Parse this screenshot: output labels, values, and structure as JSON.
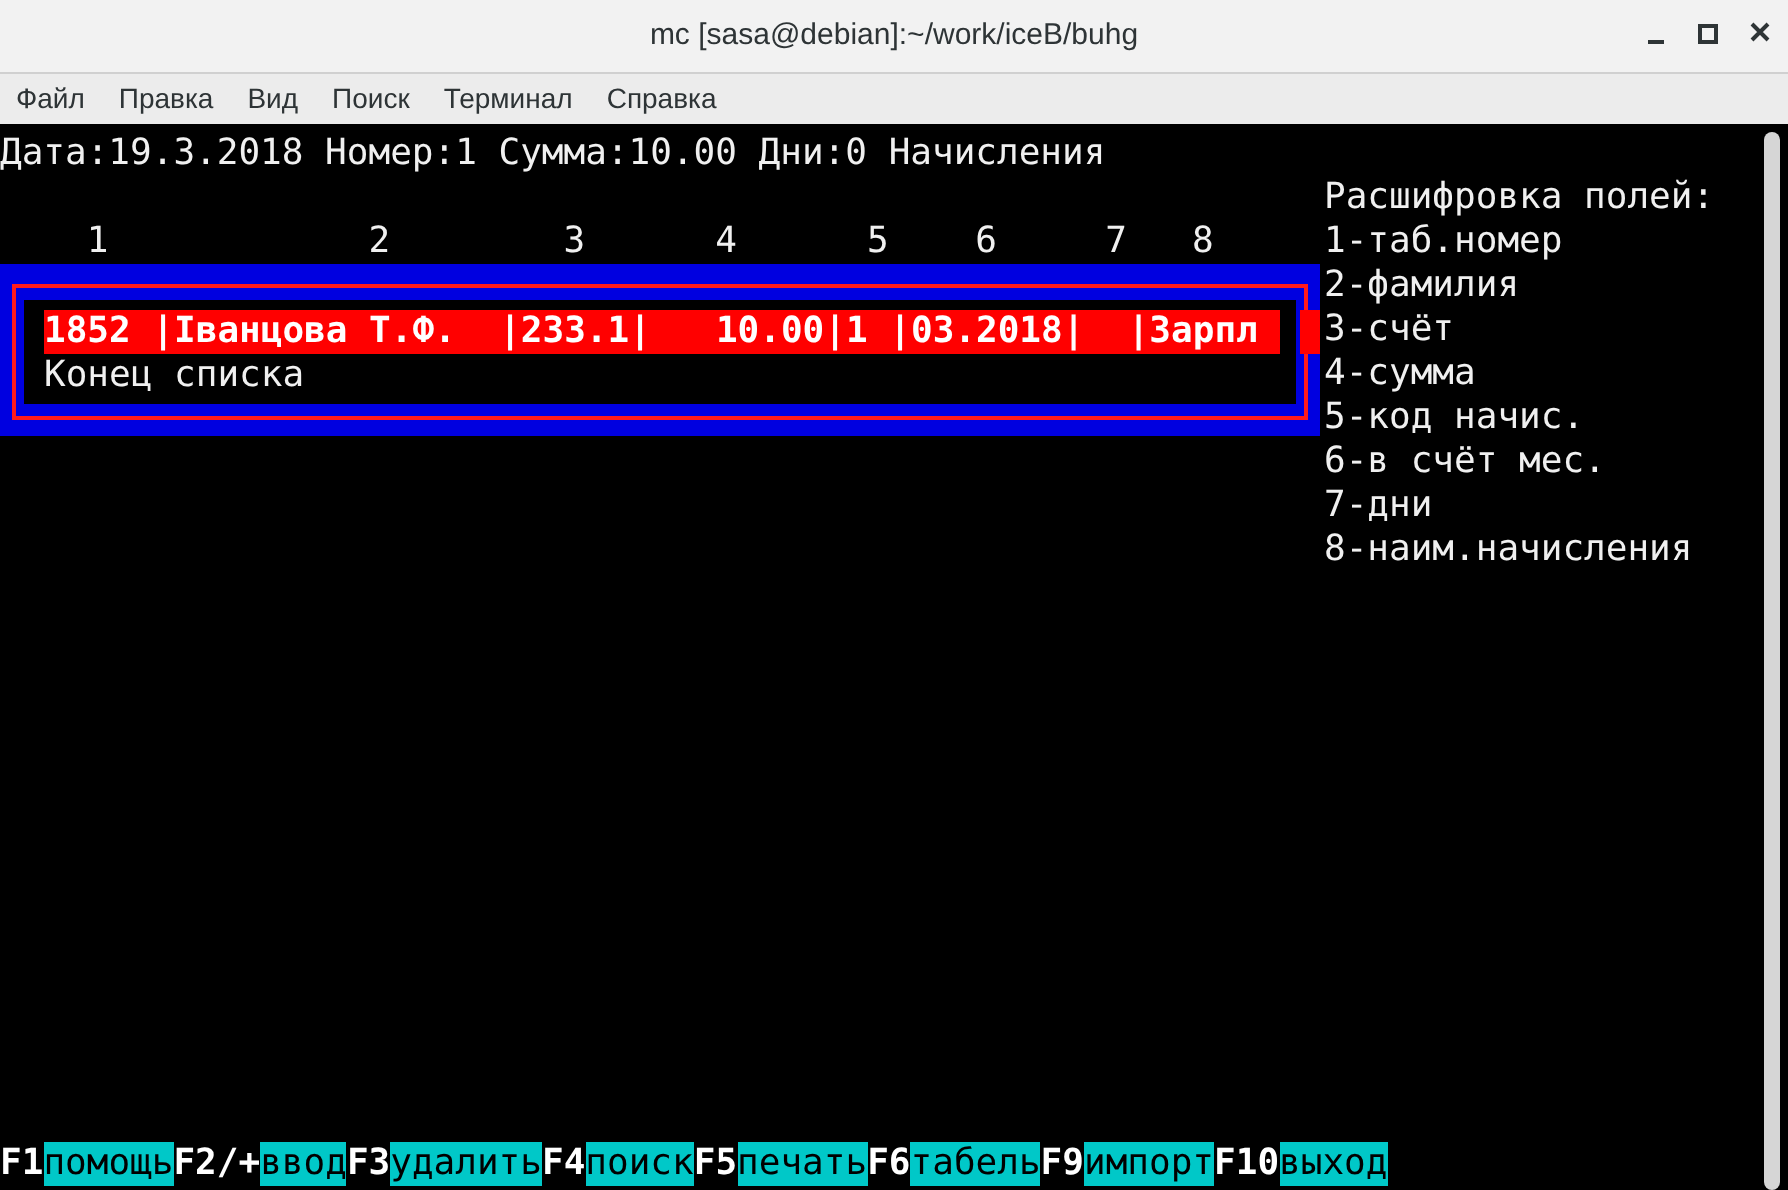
{
  "window": {
    "title": "mc [sasa@debian]:~/work/iceB/buhg"
  },
  "menu": [
    "Файл",
    "Правка",
    "Вид",
    "Поиск",
    "Терминал",
    "Справка"
  ],
  "header": "Дата:19.3.2018 Номер:1 Сумма:10.00 Дни:0 Начисления",
  "columns": [
    "1",
    "2",
    "3",
    "4",
    "5",
    "6",
    "7",
    "8"
  ],
  "rows": [
    {
      "text": "1852 |Іванцова Т.Ф.  |233.1|   10.00|1 |03.2018|  |Зарпл",
      "selected": true
    },
    {
      "text": "Конец списка",
      "selected": false
    }
  ],
  "legend": [
    "Расшифровка полей:",
    "1-таб.номер",
    "2-фамилия",
    "3-счёт",
    "4-сумма",
    "5-код начис.",
    "6-в счёт мес.",
    "7-дни",
    "8-наим.начисления"
  ],
  "function_keys": [
    {
      "key": "F1",
      "label": "помощь"
    },
    {
      "key": "F2/+",
      "label": "ввод"
    },
    {
      "key": "F3",
      "label": "удалить"
    },
    {
      "key": "F4",
      "label": "поиск"
    },
    {
      "key": "F5",
      "label": "печать"
    },
    {
      "key": "F6",
      "label": "табель"
    },
    {
      "key": "F9",
      "label": "импорт"
    },
    {
      "key": "F10",
      "label": "выход"
    }
  ]
}
